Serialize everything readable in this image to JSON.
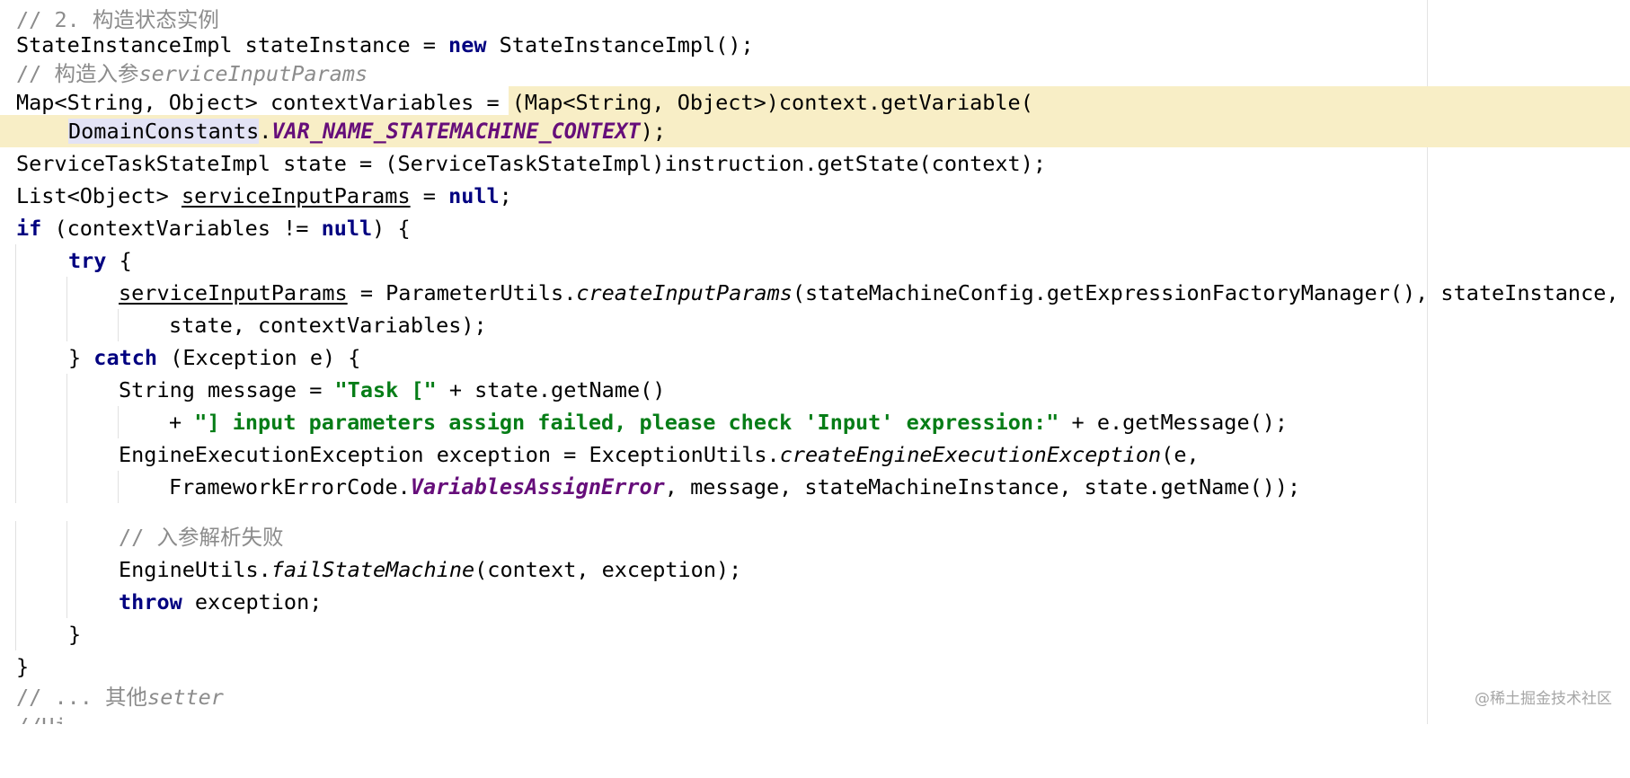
{
  "editor": {
    "lines": [
      {
        "segments": [
          {
            "text": "// 2. 构造状态实例",
            "style": "cm"
          }
        ]
      },
      {
        "segments": [
          {
            "text": "StateInstanceImpl stateInstance = "
          },
          {
            "text": "new",
            "style": "kw"
          },
          {
            "text": " StateInstanceImpl();"
          }
        ]
      },
      {
        "segments": [
          {
            "text": "// 构造入参",
            "style": "cm"
          },
          {
            "text": "serviceInputParams",
            "style": "cmi"
          }
        ]
      },
      {
        "segments": [
          {
            "text": "Map<String, Object> contextVariables = "
          },
          {
            "text": "(Map<String, Object>)context.getVariable("
          }
        ]
      },
      {
        "segments": [
          {
            "text": "DomainConstants",
            "style": "sel"
          },
          {
            "text": "."
          },
          {
            "text": "VAR_NAME_STATEMACHINE_CONTEXT",
            "style": "const"
          },
          {
            "text": ");"
          }
        ]
      },
      {
        "segments": [
          {
            "text": "ServiceTaskStateImpl state = (ServiceTaskStateImpl)instruction.getState(context);"
          }
        ]
      },
      {
        "segments": [
          {
            "text": "List<Object> "
          },
          {
            "text": "serviceInputParams",
            "style": "ul"
          },
          {
            "text": " = "
          },
          {
            "text": "null",
            "style": "kw"
          },
          {
            "text": ";"
          }
        ]
      },
      {
        "segments": [
          {
            "text": "if",
            "style": "kw"
          },
          {
            "text": " (contextVariables != "
          },
          {
            "text": "null",
            "style": "kw"
          },
          {
            "text": ") {"
          }
        ]
      },
      {
        "segments": [
          {
            "text": "try",
            "style": "kw"
          },
          {
            "text": " {"
          }
        ]
      },
      {
        "segments": [
          {
            "text": "serviceInputParams",
            "style": "ul"
          },
          {
            "text": " = ParameterUtils."
          },
          {
            "text": "createInputParams",
            "style": "it"
          },
          {
            "text": "(stateMachineConfig.getExpressionFactoryManager(), stateInstance,"
          }
        ]
      },
      {
        "segments": [
          {
            "text": "state, contextVariables);"
          }
        ]
      },
      {
        "segments": [
          {
            "text": "} "
          },
          {
            "text": "catch",
            "style": "kw"
          },
          {
            "text": " (Exception e) {"
          }
        ]
      },
      {
        "segments": [
          {
            "text": "String message = "
          },
          {
            "text": "\"Task [\"",
            "style": "str"
          },
          {
            "text": " + state.getName()"
          }
        ]
      },
      {
        "segments": [
          {
            "text": "+ "
          },
          {
            "text": "\"] input parameters assign failed, please check 'Input' expression:\"",
            "style": "str"
          },
          {
            "text": " + e.getMessage();"
          }
        ]
      },
      {
        "segments": [
          {
            "text": "EngineExecutionException exception = ExceptionUtils."
          },
          {
            "text": "createEngineExecutionException",
            "style": "it"
          },
          {
            "text": "(e,"
          }
        ]
      },
      {
        "segments": [
          {
            "text": "FrameworkErrorCode."
          },
          {
            "text": "VariablesAssignError",
            "style": "const"
          },
          {
            "text": ", message, stateMachineInstance, state.getName());"
          }
        ]
      },
      {
        "segments": [
          {
            "text": "// 入参解析失败",
            "style": "cm"
          }
        ]
      },
      {
        "segments": [
          {
            "text": "EngineUtils."
          },
          {
            "text": "failStateMachine",
            "style": "it"
          },
          {
            "text": "(context, exception);"
          }
        ]
      },
      {
        "segments": [
          {
            "text": "throw",
            "style": "kw"
          },
          {
            "text": " exception;"
          }
        ]
      },
      {
        "segments": [
          {
            "text": "}"
          }
        ]
      },
      {
        "segments": [
          {
            "text": "}"
          }
        ]
      },
      {
        "segments": [
          {
            "text": "// ... 其他",
            "style": "cm"
          },
          {
            "text": "setter",
            "style": "cmi"
          }
        ]
      },
      {
        "segments": [
          {
            "text": "//Hi",
            "style": "cm"
          }
        ]
      }
    ]
  },
  "watermark": "@稀土掘金技术社区"
}
